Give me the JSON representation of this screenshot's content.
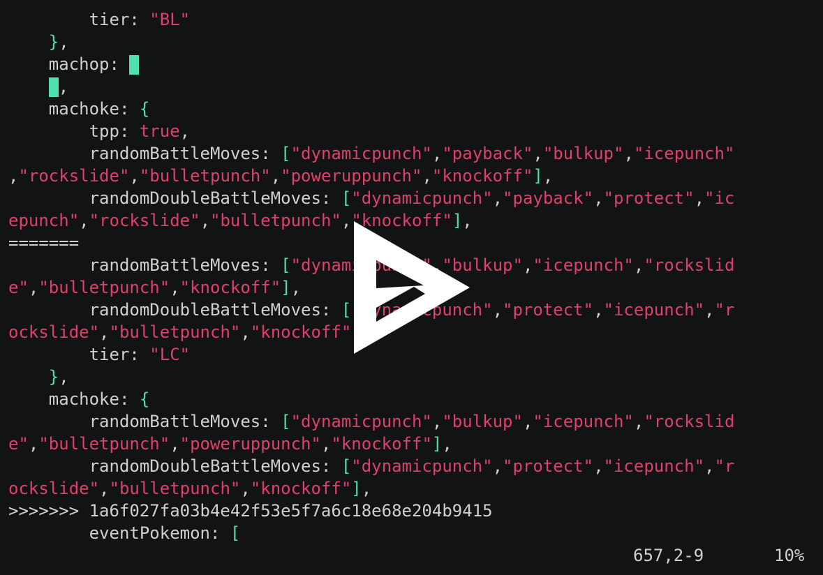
{
  "terminal": {
    "colors": {
      "background": "#111315",
      "text": "#d0d0d0",
      "string": "#e0406a",
      "punctuation": "#4fe0b0",
      "cursor": "#4fe0b0",
      "play_overlay": "#ffffff"
    },
    "lines": [
      [
        {
          "t": "plain",
          "v": "        tier: "
        },
        {
          "t": "str",
          "v": "\"BL\""
        }
      ],
      [
        {
          "t": "plain",
          "v": "    "
        },
        {
          "t": "punct",
          "v": "}"
        },
        {
          "t": "plain",
          "v": ","
        }
      ],
      [
        {
          "t": "plain",
          "v": "    machop: "
        },
        {
          "t": "cursor",
          "v": ""
        }
      ],
      [
        {
          "t": "plain",
          "v": "    "
        },
        {
          "t": "cursor",
          "v": ""
        },
        {
          "t": "plain",
          "v": ","
        }
      ],
      [
        {
          "t": "plain",
          "v": "    machoke: "
        },
        {
          "t": "punct",
          "v": "{"
        }
      ],
      [
        {
          "t": "plain",
          "v": "        tpp: "
        },
        {
          "t": "str",
          "v": "true"
        },
        {
          "t": "plain",
          "v": ","
        }
      ],
      [
        {
          "t": "plain",
          "v": "        randomBattleMoves: "
        },
        {
          "t": "punct",
          "v": "["
        },
        {
          "t": "str",
          "v": "\"dynamicpunch\""
        },
        {
          "t": "plain",
          "v": ","
        },
        {
          "t": "str",
          "v": "\"payback\""
        },
        {
          "t": "plain",
          "v": ","
        },
        {
          "t": "str",
          "v": "\"bulkup\""
        },
        {
          "t": "plain",
          "v": ","
        },
        {
          "t": "str",
          "v": "\"icepunch\""
        }
      ],
      [
        {
          "t": "plain",
          "v": ","
        },
        {
          "t": "str",
          "v": "\"rockslide\""
        },
        {
          "t": "plain",
          "v": ","
        },
        {
          "t": "str",
          "v": "\"bulletpunch\""
        },
        {
          "t": "plain",
          "v": ","
        },
        {
          "t": "str",
          "v": "\"poweruppunch\""
        },
        {
          "t": "plain",
          "v": ","
        },
        {
          "t": "str",
          "v": "\"knockoff\""
        },
        {
          "t": "punct",
          "v": "]"
        },
        {
          "t": "plain",
          "v": ","
        }
      ],
      [
        {
          "t": "plain",
          "v": "        randomDoubleBattleMoves: "
        },
        {
          "t": "punct",
          "v": "["
        },
        {
          "t": "str",
          "v": "\"dynamicpunch\""
        },
        {
          "t": "plain",
          "v": ","
        },
        {
          "t": "str",
          "v": "\"payback\""
        },
        {
          "t": "plain",
          "v": ","
        },
        {
          "t": "str",
          "v": "\"protect\""
        },
        {
          "t": "plain",
          "v": ","
        },
        {
          "t": "str",
          "v": "\"ic"
        }
      ],
      [
        {
          "t": "str",
          "v": "epunch\""
        },
        {
          "t": "plain",
          "v": ","
        },
        {
          "t": "str",
          "v": "\"rockslide\""
        },
        {
          "t": "plain",
          "v": ","
        },
        {
          "t": "str",
          "v": "\"bulletpunch\""
        },
        {
          "t": "plain",
          "v": ","
        },
        {
          "t": "str",
          "v": "\"knockoff\""
        },
        {
          "t": "punct",
          "v": "]"
        },
        {
          "t": "plain",
          "v": ","
        }
      ],
      [
        {
          "t": "plain",
          "v": "======="
        }
      ],
      [
        {
          "t": "plain",
          "v": "        randomBattleMoves: "
        },
        {
          "t": "punct",
          "v": "["
        },
        {
          "t": "str",
          "v": "\"dynamicpunch\""
        },
        {
          "t": "plain",
          "v": ","
        },
        {
          "t": "str",
          "v": "\"bulkup\""
        },
        {
          "t": "plain",
          "v": ","
        },
        {
          "t": "str",
          "v": "\"icepunch\""
        },
        {
          "t": "plain",
          "v": ","
        },
        {
          "t": "str",
          "v": "\"rockslid"
        }
      ],
      [
        {
          "t": "str",
          "v": "e\""
        },
        {
          "t": "plain",
          "v": ","
        },
        {
          "t": "str",
          "v": "\"bulletpunch\""
        },
        {
          "t": "plain",
          "v": ","
        },
        {
          "t": "str",
          "v": "\"knockoff\""
        },
        {
          "t": "punct",
          "v": "]"
        },
        {
          "t": "plain",
          "v": ","
        }
      ],
      [
        {
          "t": "plain",
          "v": "        randomDoubleBattleMoves: "
        },
        {
          "t": "punct",
          "v": "["
        },
        {
          "t": "str",
          "v": "\"dynamicpunch\""
        },
        {
          "t": "plain",
          "v": ","
        },
        {
          "t": "str",
          "v": "\"protect\""
        },
        {
          "t": "plain",
          "v": ","
        },
        {
          "t": "str",
          "v": "\"icepunch\""
        },
        {
          "t": "plain",
          "v": ","
        },
        {
          "t": "str",
          "v": "\"r"
        }
      ],
      [
        {
          "t": "str",
          "v": "ockslide\""
        },
        {
          "t": "plain",
          "v": ","
        },
        {
          "t": "str",
          "v": "\"bulletpunch\""
        },
        {
          "t": "plain",
          "v": ","
        },
        {
          "t": "str",
          "v": "\"knockoff\""
        },
        {
          "t": "punct",
          "v": "]"
        },
        {
          "t": "plain",
          "v": ","
        }
      ],
      [
        {
          "t": "plain",
          "v": "        tier: "
        },
        {
          "t": "str",
          "v": "\"LC\""
        }
      ],
      [
        {
          "t": "plain",
          "v": "    "
        },
        {
          "t": "punct",
          "v": "}"
        },
        {
          "t": "plain",
          "v": ","
        }
      ],
      [
        {
          "t": "plain",
          "v": "    machoke: "
        },
        {
          "t": "punct",
          "v": "{"
        }
      ],
      [
        {
          "t": "plain",
          "v": "        randomBattleMoves: "
        },
        {
          "t": "punct",
          "v": "["
        },
        {
          "t": "str",
          "v": "\"dynamicpunch\""
        },
        {
          "t": "plain",
          "v": ","
        },
        {
          "t": "str",
          "v": "\"bulkup\""
        },
        {
          "t": "plain",
          "v": ","
        },
        {
          "t": "str",
          "v": "\"icepunch\""
        },
        {
          "t": "plain",
          "v": ","
        },
        {
          "t": "str",
          "v": "\"rockslid"
        }
      ],
      [
        {
          "t": "str",
          "v": "e\""
        },
        {
          "t": "plain",
          "v": ","
        },
        {
          "t": "str",
          "v": "\"bulletpunch\""
        },
        {
          "t": "plain",
          "v": ","
        },
        {
          "t": "str",
          "v": "\"poweruppunch\""
        },
        {
          "t": "plain",
          "v": ","
        },
        {
          "t": "str",
          "v": "\"knockoff\""
        },
        {
          "t": "punct",
          "v": "]"
        },
        {
          "t": "plain",
          "v": ","
        }
      ],
      [
        {
          "t": "plain",
          "v": "        randomDoubleBattleMoves: "
        },
        {
          "t": "punct",
          "v": "["
        },
        {
          "t": "str",
          "v": "\"dynamicpunch\""
        },
        {
          "t": "plain",
          "v": ","
        },
        {
          "t": "str",
          "v": "\"protect\""
        },
        {
          "t": "plain",
          "v": ","
        },
        {
          "t": "str",
          "v": "\"icepunch\""
        },
        {
          "t": "plain",
          "v": ","
        },
        {
          "t": "str",
          "v": "\"r"
        }
      ],
      [
        {
          "t": "str",
          "v": "ockslide\""
        },
        {
          "t": "plain",
          "v": ","
        },
        {
          "t": "str",
          "v": "\"bulletpunch\""
        },
        {
          "t": "plain",
          "v": ","
        },
        {
          "t": "str",
          "v": "\"knockoff\""
        },
        {
          "t": "punct",
          "v": "]"
        },
        {
          "t": "plain",
          "v": ","
        }
      ],
      [
        {
          "t": "plain",
          "v": ">>>>>>> 1a6f027fa03b4e42f53e5f7a6c18e68e204b9415"
        }
      ],
      [
        {
          "t": "plain",
          "v": "        eventPokemon: "
        },
        {
          "t": "punct",
          "v": "["
        }
      ]
    ]
  },
  "status_bar": {
    "position": "657,2-9",
    "percent": "10%"
  },
  "overlay": {
    "icon": "play-icon"
  }
}
